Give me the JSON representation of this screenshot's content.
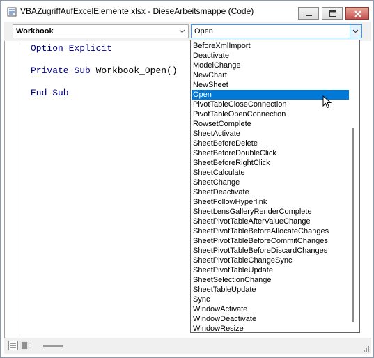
{
  "window": {
    "title": "VBAZugriffAufExcelElemente.xlsx - DieseArbeitsmappe (Code)"
  },
  "toolbar": {
    "object_combo_value": "Workbook",
    "procedure_combo_value": "Open"
  },
  "code": {
    "lines": [
      "Option Explicit",
      "Private Sub Workbook_Open()",
      "End Sub"
    ]
  },
  "dropdown": {
    "selected": "Open",
    "items": [
      "BeforeXmlImport",
      "Deactivate",
      "ModelChange",
      "NewChart",
      "NewSheet",
      "Open",
      "PivotTableCloseConnection",
      "PivotTableOpenConnection",
      "RowsetComplete",
      "SheetActivate",
      "SheetBeforeDelete",
      "SheetBeforeDoubleClick",
      "SheetBeforeRightClick",
      "SheetCalculate",
      "SheetChange",
      "SheetDeactivate",
      "SheetFollowHyperlink",
      "SheetLensGalleryRenderComplete",
      "SheetPivotTableAfterValueChange",
      "SheetPivotTableBeforeAllocateChanges",
      "SheetPivotTableBeforeCommitChanges",
      "SheetPivotTableBeforeDiscardChanges",
      "SheetPivotTableChangeSync",
      "SheetPivotTableUpdate",
      "SheetSelectionChange",
      "SheetTableUpdate",
      "Sync",
      "WindowActivate",
      "WindowDeactivate",
      "WindowResize"
    ]
  },
  "icons": {
    "title": "vba-module-icon",
    "minimize": "minimize-icon",
    "maximize": "maximize-icon",
    "close": "close-icon",
    "dropdown_arrow": "chevron-down-icon"
  },
  "colors": {
    "keyword": "#00008b",
    "selection": "#0078d7",
    "close_button": "#c75050"
  }
}
